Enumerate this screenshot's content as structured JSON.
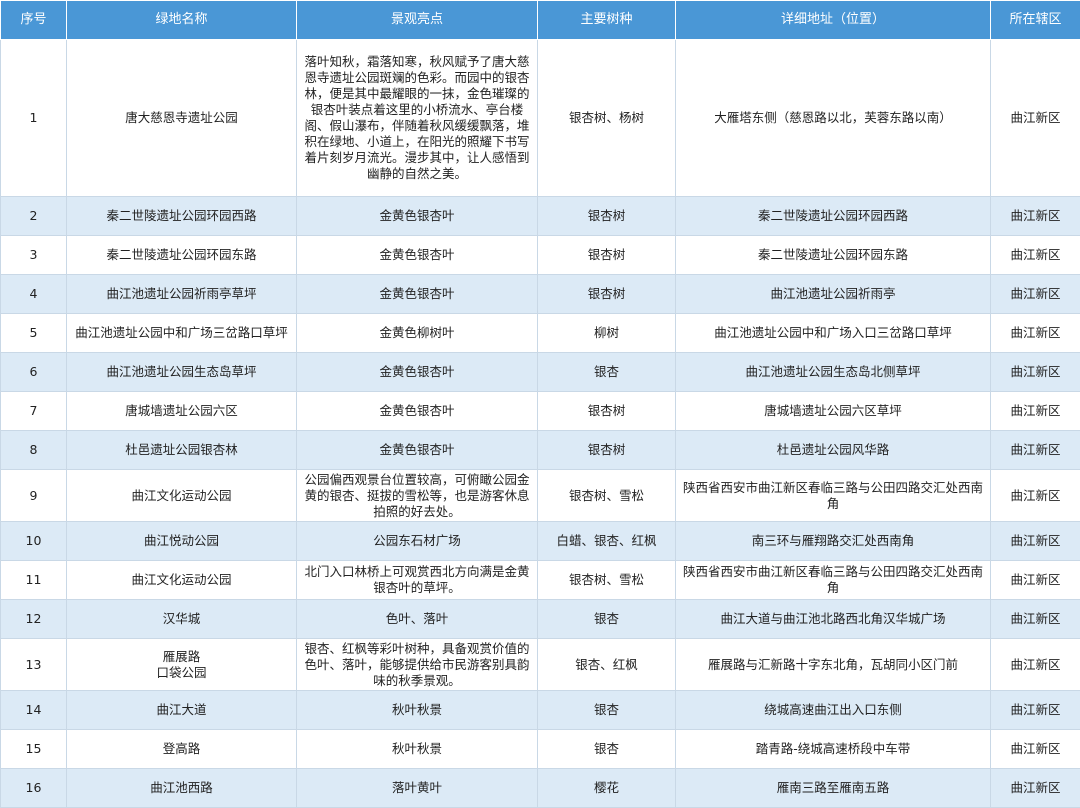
{
  "headers": [
    "序号",
    "绿地名称",
    "景观亮点",
    "主要树种",
    "详细地址（位置）",
    "所在辖区"
  ],
  "rows": [
    {
      "no": "1",
      "name": "唐大慈恩寺遗址公园",
      "highlight": "落叶知秋，霜落知寒，秋风赋予了唐大慈恩寺遗址公园斑斓的色彩。而园中的银杏林，便是其中最耀眼的一抹，金色璀璨的银杏叶装点着这里的小桥流水、亭台楼阁、假山瀑布，伴随着秋风缓缓飘落，堆积在绿地、小道上，在阳光的照耀下书写着片刻岁月流光。漫步其中，让人感悟到幽静的自然之美。",
      "trees": "银杏树、杨树",
      "address": "大雁塔东侧（慈恩路以北，芙蓉东路以南）",
      "district": "曲江新区"
    },
    {
      "no": "2",
      "name": "秦二世陵遗址公园环园西路",
      "highlight": "金黄色银杏叶",
      "trees": "银杏树",
      "address": "秦二世陵遗址公园环园西路",
      "district": "曲江新区"
    },
    {
      "no": "3",
      "name": "秦二世陵遗址公园环园东路",
      "highlight": "金黄色银杏叶",
      "trees": "银杏树",
      "address": "秦二世陵遗址公园环园东路",
      "district": "曲江新区"
    },
    {
      "no": "4",
      "name": "曲江池遗址公园祈雨亭草坪",
      "highlight": "金黄色银杏叶",
      "trees": "银杏树",
      "address": "曲江池遗址公园祈雨亭",
      "district": "曲江新区"
    },
    {
      "no": "5",
      "name": "曲江池遗址公园中和广场三岔路口草坪",
      "highlight": "金黄色柳树叶",
      "trees": "柳树",
      "address": "曲江池遗址公园中和广场入口三岔路口草坪",
      "district": "曲江新区"
    },
    {
      "no": "6",
      "name": "曲江池遗址公园生态岛草坪",
      "highlight": "金黄色银杏叶",
      "trees": "银杏",
      "address": "曲江池遗址公园生态岛北侧草坪",
      "district": "曲江新区"
    },
    {
      "no": "7",
      "name": "唐城墙遗址公园六区",
      "highlight": "金黄色银杏叶",
      "trees": "银杏树",
      "address": "唐城墙遗址公园六区草坪",
      "district": "曲江新区"
    },
    {
      "no": "8",
      "name": "杜邑遗址公园银杏林",
      "highlight": "金黄色银杏叶",
      "trees": "银杏树",
      "address": "杜邑遗址公园风华路",
      "district": "曲江新区"
    },
    {
      "no": "9",
      "name": "曲江文化运动公园",
      "highlight": "公园偏西观景台位置较高，可俯瞰公园金黄的银杏、挺拔的雪松等，也是游客休息拍照的好去处。",
      "trees": "银杏树、雪松",
      "address": "陕西省西安市曲江新区春临三路与公田四路交汇处西南角",
      "district": "曲江新区"
    },
    {
      "no": "10",
      "name": "曲江悦动公园",
      "highlight": "公园东石材广场",
      "trees": "白蜡、银杏、红枫",
      "address": "南三环与雁翔路交汇处西南角",
      "district": "曲江新区"
    },
    {
      "no": "11",
      "name": "曲江文化运动公园",
      "highlight": "北门入口林桥上可观赏西北方向满是金黄银杏叶的草坪。",
      "trees": "银杏树、雪松",
      "address": "陕西省西安市曲江新区春临三路与公田四路交汇处西南角",
      "district": "曲江新区"
    },
    {
      "no": "12",
      "name": "汉华城",
      "highlight": "色叶、落叶",
      "trees": "银杏",
      "address": "曲江大道与曲江池北路西北角汉华城广场",
      "district": "曲江新区"
    },
    {
      "no": "13",
      "name": "雁展路\n口袋公园",
      "highlight": "银杏、红枫等彩叶树种，具备观赏价值的色叶、落叶，能够提供给市民游客别具韵味的秋季景观。",
      "trees": "银杏、红枫",
      "address": "雁展路与汇新路十字东北角，瓦胡同小区门前",
      "district": "曲江新区"
    },
    {
      "no": "14",
      "name": "曲江大道",
      "highlight": "秋叶秋景",
      "trees": "银杏",
      "address": "绕城高速曲江出入口东侧",
      "district": "曲江新区"
    },
    {
      "no": "15",
      "name": "登高路",
      "highlight": "秋叶秋景",
      "trees": "银杏",
      "address": "踏青路-绕城高速桥段中车带",
      "district": "曲江新区"
    },
    {
      "no": "16",
      "name": "曲江池西路",
      "highlight": "落叶黄叶",
      "trees": "樱花",
      "address": "雁南三路至雁南五路",
      "district": "曲江新区"
    }
  ],
  "colors": {
    "header": "#4a97d6",
    "stripe": "#dceaf6",
    "border": "#c9d8e6"
  }
}
